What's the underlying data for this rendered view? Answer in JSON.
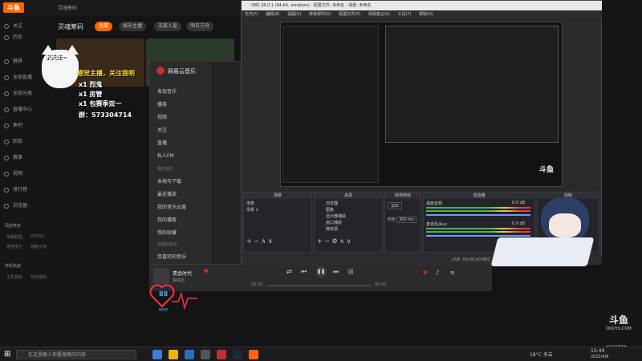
{
  "app": {
    "logo": "斗鱼",
    "tab_title": "灵魂筹码"
  },
  "sidebar": {
    "items": [
      {
        "label": "关注"
      },
      {
        "label": "历史"
      },
      {
        "label": "推荐"
      },
      {
        "label": "全部直播"
      },
      {
        "label": "全部分类"
      },
      {
        "label": "直播中心"
      },
      {
        "label": "鱼吧"
      },
      {
        "label": "回放"
      },
      {
        "label": "赛事"
      },
      {
        "label": "视频"
      },
      {
        "label": "排行榜"
      },
      {
        "label": "浏览器"
      }
    ],
    "section_games": "网游竞技",
    "games": [
      "英雄联盟",
      "DOTA2",
      "绝地求生",
      "穿越火线"
    ],
    "section_single": "单机热游",
    "single": [
      "主机游戏",
      "怀旧游戏"
    ]
  },
  "header": {
    "title": "灵魂筹码",
    "chips": [
      "全部",
      "娱乐主播",
      "无敌人皇",
      "明日方舟"
    ]
  },
  "stream_overlay": {
    "follow_text": "求关注~",
    "promo": "感觉主播，关注我吧",
    "gifts": [
      {
        "count": "x1",
        "name": "烈鬼"
      },
      {
        "count": "x1",
        "name": "房管"
      },
      {
        "count": "x1",
        "name": "包赛季双一"
      }
    ],
    "group": "群：573304714"
  },
  "music": {
    "title": "网易云音乐",
    "nav": [
      "发现音乐",
      "播客",
      "视频",
      "关注",
      "直播",
      "私人FM"
    ],
    "section_mine": "我的音乐",
    "mine": [
      "本地与下载",
      "最近播放",
      "我的音乐云盘",
      "我的播客",
      "我的收藏"
    ],
    "section_lists": "创建的歌单",
    "lists": [
      "我喜欢的音乐"
    ],
    "song": "青金时代",
    "artist": "陈奕迅",
    "time_now": "00:00",
    "time_total": "00:00",
    "heart_bpm": "88",
    "bpm_label": "BPM"
  },
  "obs": {
    "window_title": "OBS 28.0.1 (64-bit, windows) - 配置文件: 未命名 - 场景: 未命名",
    "menu": [
      "文件(F)",
      "编辑(E)",
      "视图(V)",
      "停靠部件(D)",
      "配置文件(P)",
      "场景集合(S)",
      "工具(T)",
      "帮助(H)"
    ],
    "docks": {
      "scenes": "场景",
      "sources": "来源",
      "transitions": "转场特效",
      "mixer": "混音器",
      "controls": "控制"
    },
    "scenes_list": [
      "场景",
      "场景 2"
    ],
    "sources_list": [
      "浏览器",
      "图像",
      "显示器捕获",
      "窗口捕获",
      "媒体源"
    ],
    "transition": "淡出",
    "duration_label": "时长",
    "duration_value": "300 ms",
    "mixer": [
      {
        "name": "桌面音频",
        "db": "0.0 dB"
      },
      {
        "name": "麦克风/Aux",
        "db": "0.0 dB"
      }
    ],
    "status": "LIVE: 00:00:00  REC: 00:00:00  CPU: 1.1%, 60.00 fps",
    "preview_tag": "斗鱼"
  },
  "right": {
    "douyu_logo": "斗鱼",
    "douyu_sub": "DOUYU.COM",
    "room_id": "4562770",
    "date": "2022/4/6"
  },
  "taskbar": {
    "search_placeholder": "在这里输入你要搜索的内容",
    "weather": "18°C 多云",
    "time": "15:49",
    "date": "2022/4/6"
  },
  "colors": {
    "accent": "#ff6600",
    "bg": "#141416",
    "heart": "#ff3040"
  }
}
